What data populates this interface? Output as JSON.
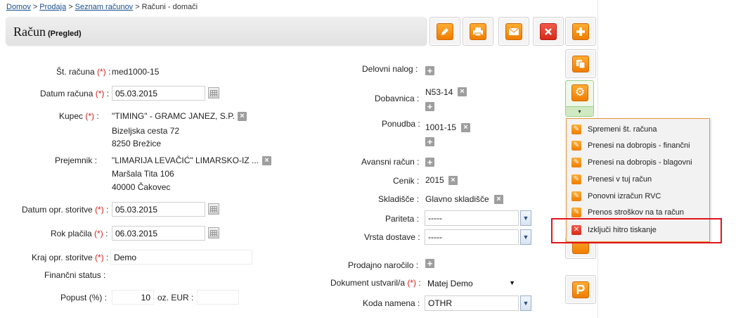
{
  "breadcrumb": {
    "items": [
      "Domov",
      "Prodaja",
      "Seznam računov",
      "Računi - domači"
    ],
    "sep": ">"
  },
  "title": {
    "main": "Račun",
    "sub": "(Pregled)"
  },
  "toolbar": {
    "icons": [
      "pencil-icon",
      "print-icon",
      "mail-icon",
      "close-icon",
      "plus-icon",
      "copy-icon",
      "gear-icon",
      "p-icon"
    ],
    "side_arrow": "▾"
  },
  "left": {
    "st_racuna_label": "Št. računa",
    "st_racuna": "med1000-15",
    "datum_label": "Datum računa",
    "datum": "05.03.2015",
    "kupec_label": "Kupec",
    "kupec_name": "\"TIMING\" - GRAMC JANEZ, S.P.",
    "kupec_addr1": "Bizeljska cesta 72",
    "kupec_addr2": "8250 Brežice",
    "prejemnik_label": "Prejemnik",
    "prejemnik_name": "\"LIMARIJA LEVAČIĆ\" LIMARSKO-IZ ...",
    "prejemnik_addr1": "Maršala Tita 106",
    "prejemnik_addr2": "40000 Čakovec",
    "datum_opr_label": "Datum opr. storitve",
    "datum_opr": "05.03.2015",
    "rok_label": "Rok plačila",
    "rok": "06.03.2015",
    "kraj_label": "Kraj opr. storitve",
    "kraj": "Demo",
    "fin_label": "Finančni status :",
    "popust_label": "Popust (%) :",
    "popust": "10",
    "ozeur_label": "oz. EUR :",
    "ozeur": ""
  },
  "common": {
    "req": "(*)",
    "colon": ":",
    "x": "×",
    "plus": "+"
  },
  "right": {
    "delovni_label": "Delovni nalog :",
    "dobavnica_label": "Dobavnica :",
    "dobavnica": "N53-14",
    "ponudba_label": "Ponudba :",
    "ponudba": "1001-15",
    "avansni_label": "Avansni račun :",
    "cenik_label": "Cenik :",
    "cenik": "2015",
    "skladisce_label": "Skladišče :",
    "skladisce": "Glavno skladišče",
    "pariteta_label": "Pariteta :",
    "pariteta": "-----",
    "vrsta_label": "Vrsta dostave :",
    "vrsta": "-----",
    "prodajno_label": "Prodajno naročilo :",
    "dokument_label": "Dokument ustvaril/a",
    "dokument": "Matej Demo",
    "koda_label": "Koda namena :",
    "koda": "OTHR"
  },
  "dropdown": {
    "items": [
      {
        "label": "Spremeni št. računa",
        "icon": "pencil-icon"
      },
      {
        "label": "Prenesi na dobropis - finančni",
        "icon": "pencil-icon"
      },
      {
        "label": "Prenesi na dobropis - blagovni",
        "icon": "pencil-icon"
      },
      {
        "label": "Prenesi v tuj račun",
        "icon": "pencil-icon"
      },
      {
        "label": "Ponovni izračun RVC",
        "icon": "pencil-icon"
      },
      {
        "label": "Prenos stroškov na ta račun",
        "icon": "pencil-icon"
      },
      {
        "label": "Izključi hitro tiskanje",
        "icon": "close-icon"
      }
    ]
  },
  "colors": {
    "accent": "#ef7d00",
    "highlight": "#e0141c",
    "link": "#1a4f8f"
  }
}
